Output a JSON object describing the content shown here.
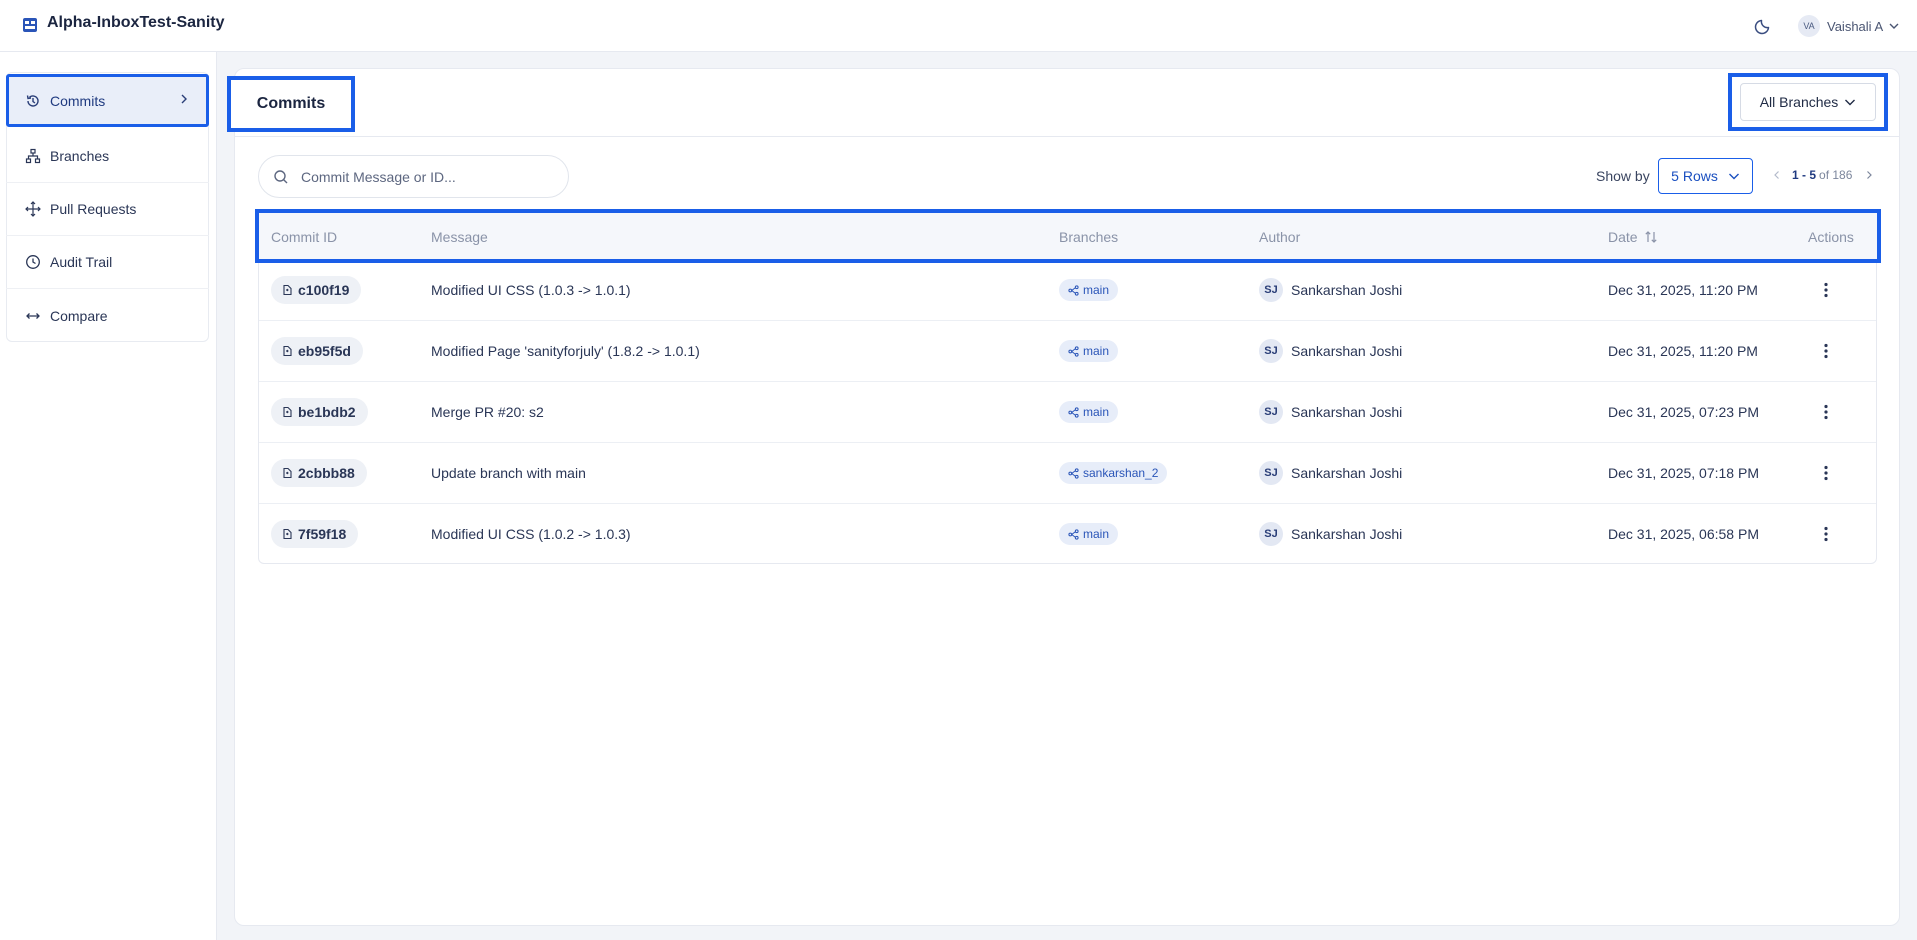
{
  "app": {
    "title": "Alpha-InboxTest-Sanity"
  },
  "user": {
    "initials": "VA",
    "name": "Vaishali A"
  },
  "sidebar": {
    "items": [
      {
        "label": "Commits",
        "icon": "history-icon",
        "active": true
      },
      {
        "label": "Branches",
        "icon": "branches-icon"
      },
      {
        "label": "Pull Requests",
        "icon": "move-arrows-icon"
      },
      {
        "label": "Audit Trail",
        "icon": "clock-icon"
      },
      {
        "label": "Compare",
        "icon": "compare-arrows-icon"
      }
    ]
  },
  "page": {
    "title": "Commits",
    "branch_filter": "All Branches"
  },
  "search": {
    "placeholder": "Commit Message or ID..."
  },
  "pagination": {
    "show_by_label": "Show by",
    "rows_option": "5 Rows",
    "range": "1 - 5",
    "of_total": "of 186"
  },
  "table": {
    "columns": [
      "Commit ID",
      "Message",
      "Branches",
      "Author",
      "Date",
      "Actions"
    ],
    "rows": [
      {
        "id": "c100f19",
        "message": "Modified UI CSS (1.0.3 -> 1.0.1)",
        "branch": "main",
        "author_initials": "SJ",
        "author": "Sankarshan Joshi",
        "date": "Dec 31, 2025, 11:20 PM"
      },
      {
        "id": "eb95f5d",
        "message": "Modified Page 'sanityforjuly' (1.8.2 -> 1.0.1)",
        "branch": "main",
        "author_initials": "SJ",
        "author": "Sankarshan Joshi",
        "date": "Dec 31, 2025, 11:20 PM"
      },
      {
        "id": "be1bdb2",
        "message": "Merge PR #20: s2",
        "branch": "main",
        "author_initials": "SJ",
        "author": "Sankarshan Joshi",
        "date": "Dec 31, 2025, 07:23 PM"
      },
      {
        "id": "2cbbb88",
        "message": "Update branch with main",
        "branch": "sankarshan_2",
        "author_initials": "SJ",
        "author": "Sankarshan Joshi",
        "date": "Dec 31, 2025, 07:18 PM"
      },
      {
        "id": "7f59f18",
        "message": "Modified UI CSS (1.0.2 -> 1.0.3)",
        "branch": "main",
        "author_initials": "SJ",
        "author": "Sankarshan Joshi",
        "date": "Dec 31, 2025, 06:58 PM"
      }
    ]
  },
  "colors": {
    "accent": "#1a5ee8",
    "highlight_border": "#1a5ee8",
    "chip_bg": "#eef1f6",
    "branch_chip_bg": "#e7edf9"
  }
}
